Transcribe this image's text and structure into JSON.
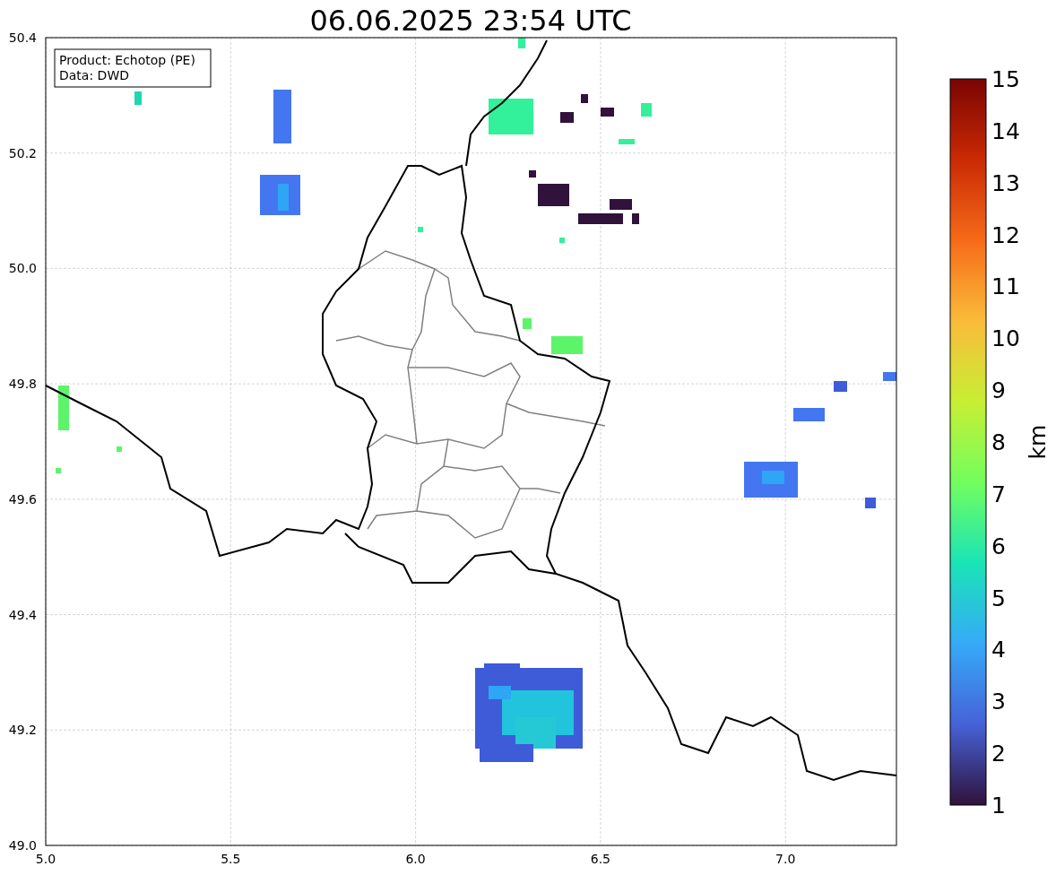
{
  "title": "06.06.2025 23:54 UTC",
  "legend": [
    "Product: Echotop (PE)",
    "Data: DWD"
  ],
  "x_axis": {
    "ticks": [
      "5.0",
      "5.5",
      "6.0",
      "6.5",
      "7.0"
    ]
  },
  "y_axis": {
    "ticks": [
      "50.4",
      "50.2",
      "50.0",
      "49.8",
      "49.6",
      "49.4",
      "49.2",
      "49.0"
    ]
  },
  "colorbar": {
    "label": "km",
    "ticks": [
      "15",
      "14",
      "13",
      "12",
      "11",
      "10",
      "9",
      "8",
      "7",
      "6",
      "5",
      "4",
      "3",
      "2",
      "1"
    ]
  }
}
